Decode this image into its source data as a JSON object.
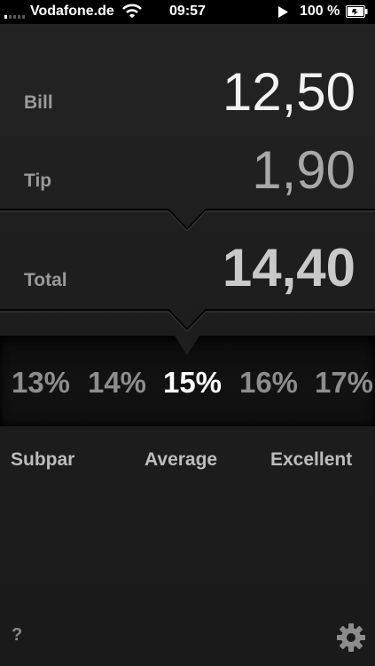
{
  "status_bar": {
    "carrier": "Vodafone.de",
    "time": "09:57",
    "battery_percent": "100 %"
  },
  "rows": {
    "bill": {
      "label": "Bill",
      "value": "12,50"
    },
    "tip": {
      "label": "Tip",
      "value": "1,90"
    },
    "total": {
      "label": "Total",
      "value": "14,40"
    }
  },
  "percentages": [
    "13%",
    "14%",
    "15%",
    "16%",
    "17%"
  ],
  "selected_percentage": "15%",
  "ratings": [
    "Subpar",
    "Average",
    "Excellent"
  ],
  "footer": {
    "help_label": "?"
  },
  "colors": {
    "background": "#1c1c1c",
    "selected_text": "#ffffff",
    "muted_text": "#8d8d8d"
  },
  "icons": [
    "cellular-signal-icon",
    "wifi-icon",
    "play-icon",
    "battery-icon",
    "gear-icon"
  ]
}
